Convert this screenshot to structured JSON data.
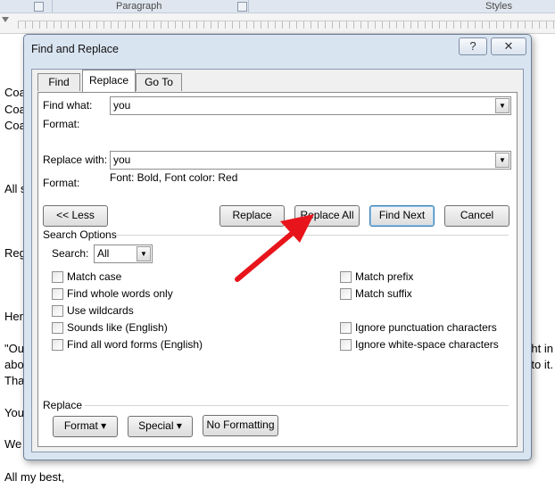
{
  "ribbon": {
    "paragraph_label": "Paragraph",
    "styles_label": "Styles"
  },
  "document_lines": [
    "Coa",
    "Coa",
    "Coa",
    "All s",
    "Reg",
    "Her",
    "\"Ou",
    "abo",
    "Tha",
    "You",
    "We",
    "All my best,"
  ],
  "document_right_fragments": [
    "ht in",
    "to it."
  ],
  "dialog": {
    "title": "Find and Replace",
    "help_label": "?",
    "close_label": "✕",
    "tabs": [
      "Find",
      "Replace",
      "Go To"
    ],
    "find_what_label": "Find what:",
    "find_what_value": "you",
    "find_format_label": "Format:",
    "replace_with_label": "Replace with:",
    "replace_with_value": "you",
    "replace_format_label": "Format:",
    "replace_format_value": "Font: Bold, Font color: Red",
    "less_button": "<< Less",
    "replace_button": "Replace",
    "replace_all_button": "Replace All",
    "find_next_button": "Find Next",
    "cancel_button": "Cancel",
    "search_options_label": "Search Options",
    "search_label": "Search:",
    "search_value": "All",
    "options_left": [
      "Match case",
      "Find whole words only",
      "Use wildcards",
      "Sounds like (English)",
      "Find all word forms (English)"
    ],
    "options_right": [
      "Match prefix",
      "Match suffix",
      "Ignore punctuation characters",
      "Ignore white-space characters"
    ],
    "replace_section_label": "Replace",
    "format_button": "Format ▾",
    "special_button": "Special ▾",
    "no_formatting_button": "No Formatting"
  },
  "colors": {
    "annotation_arrow": "#e8141b"
  }
}
